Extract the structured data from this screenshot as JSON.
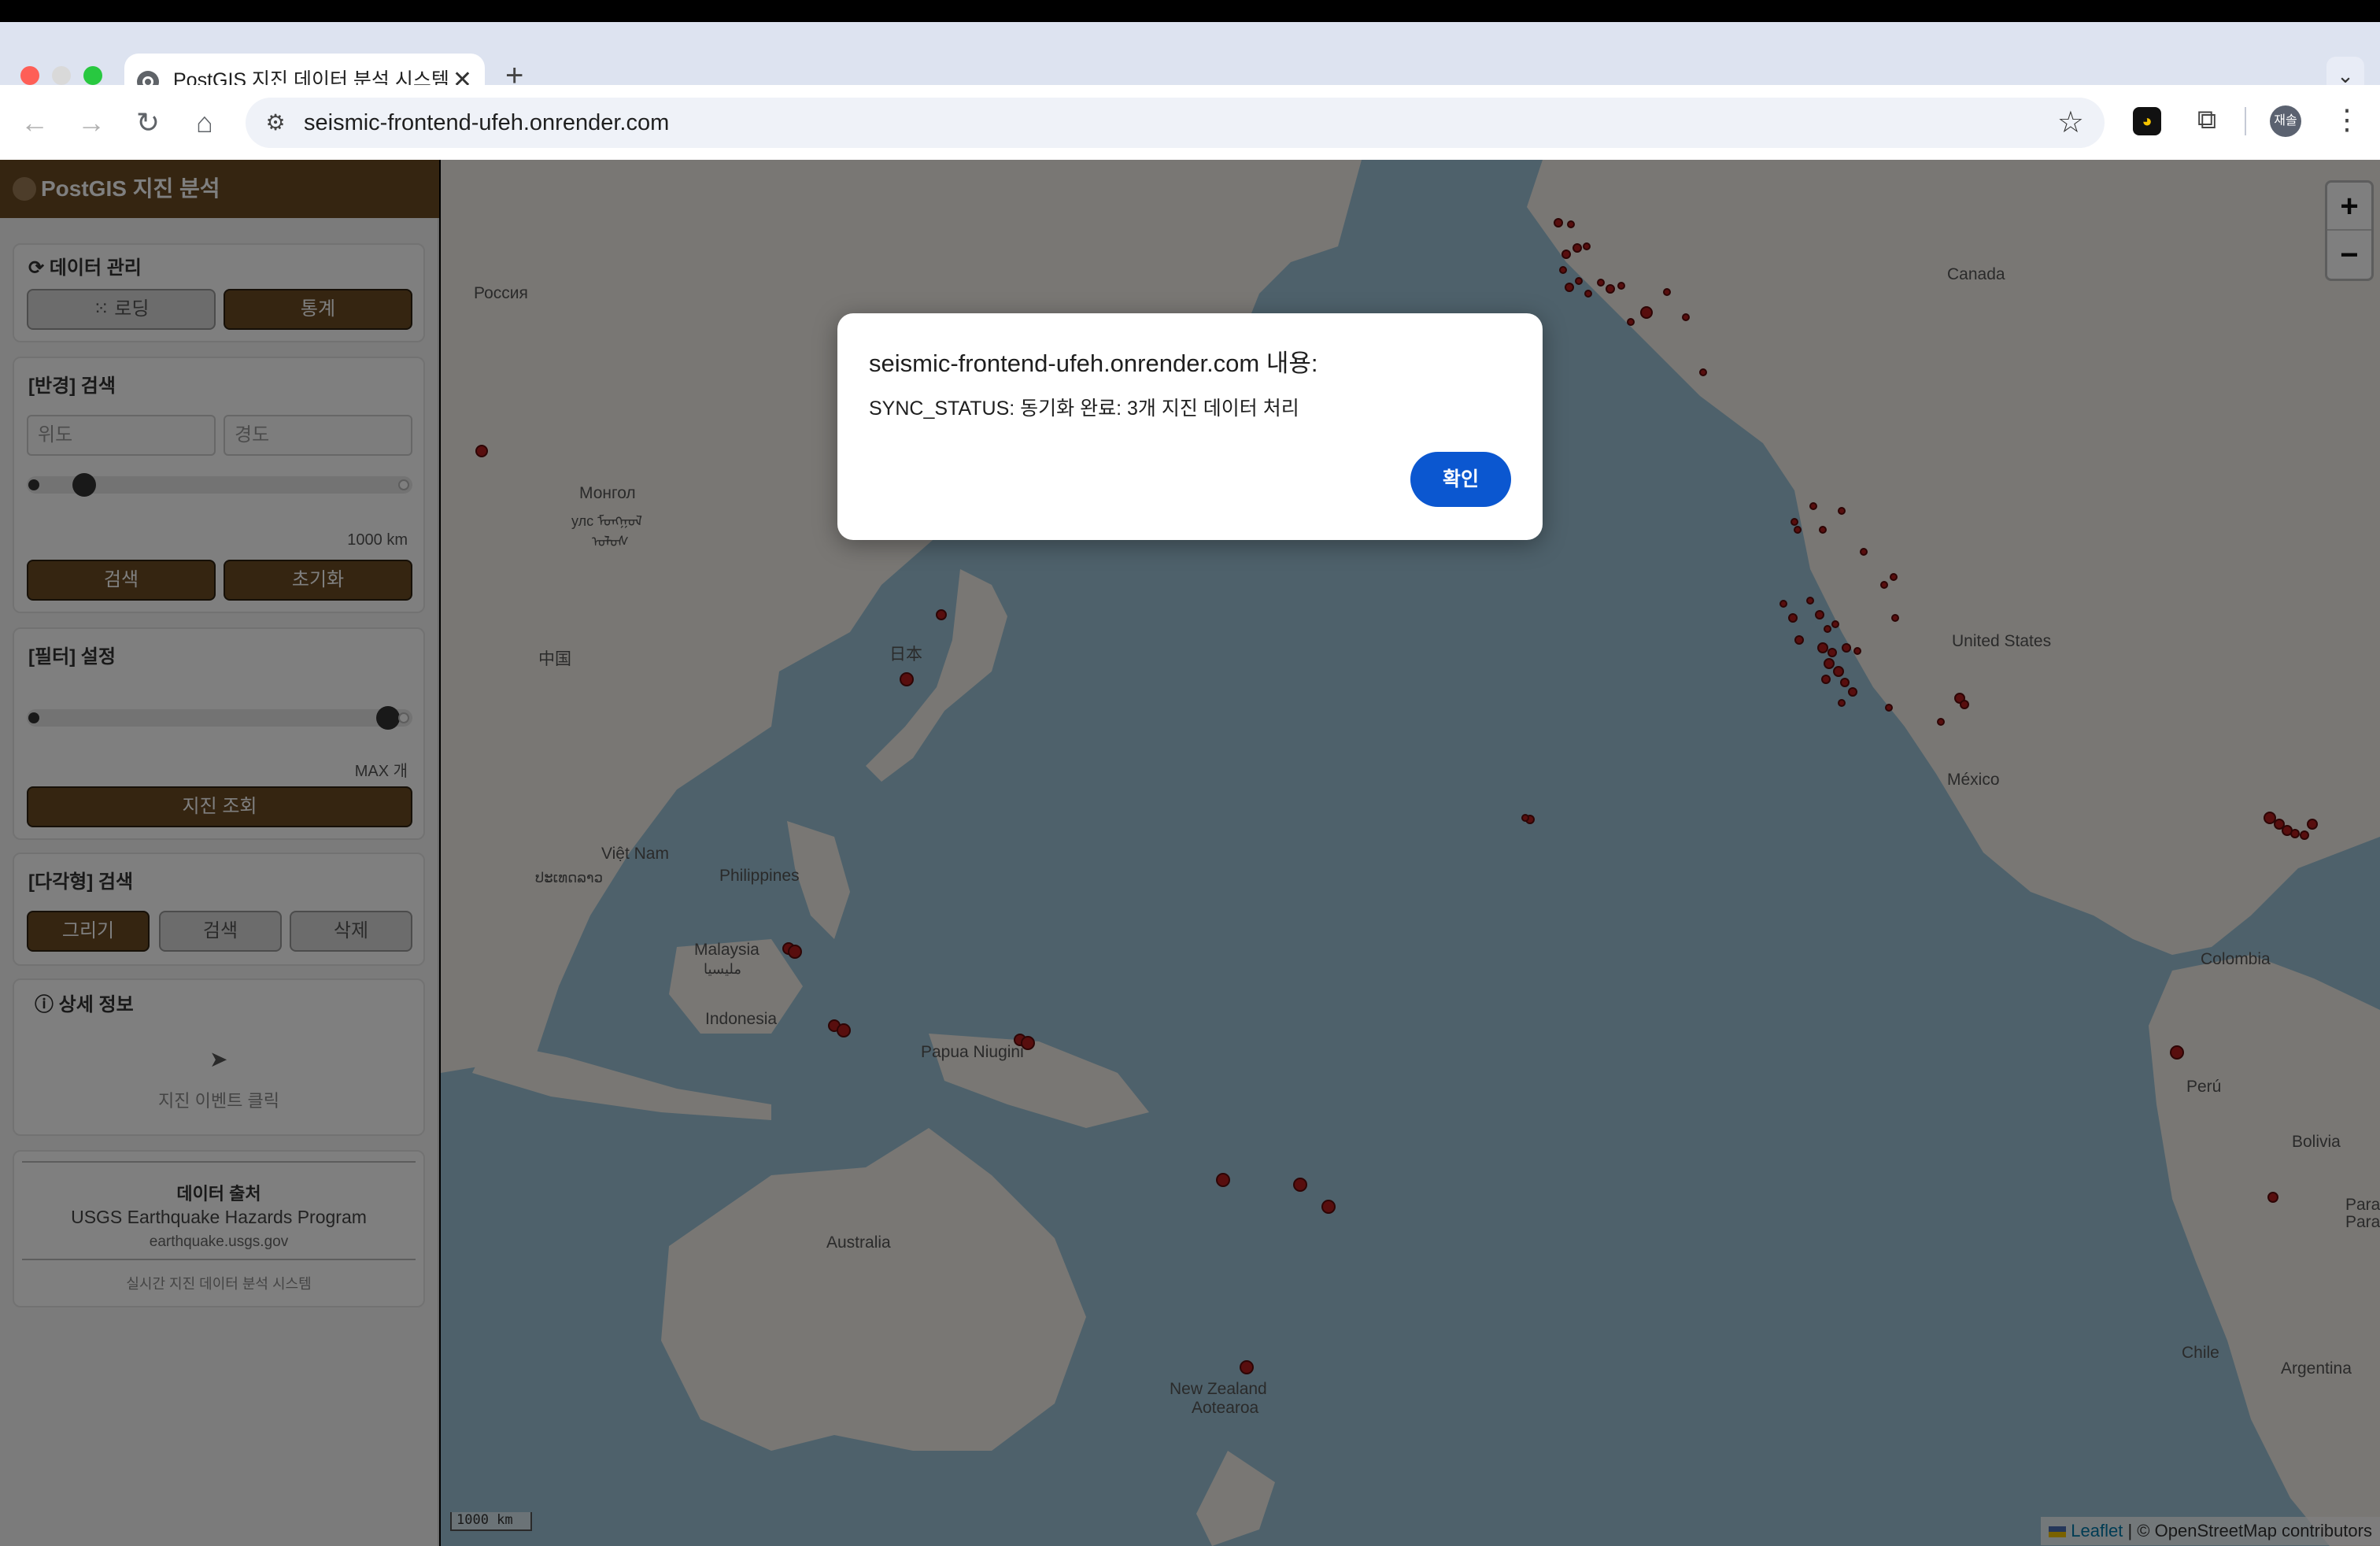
{
  "browser": {
    "tab_title": "PostGIS 지진 데이터 분석 시스템",
    "tab_close": "✕",
    "new_tab": "+",
    "tab_dropdown": "⌄",
    "url": "seismic-frontend-ufeh.onrender.com",
    "profile_initials": "재솔",
    "icons": [
      "back-icon",
      "forward-icon",
      "reload-icon",
      "home-icon",
      "site-info-icon",
      "bookmark-star-icon",
      "extension-icon",
      "puzzle-icon",
      "menu-dots-icon"
    ]
  },
  "sidebar": {
    "brand": "PostGIS 지진 분석",
    "data_mgmt": {
      "title": "데이터 관리",
      "loading_btn": "로딩",
      "stats_btn": "통계"
    },
    "radius": {
      "title": "[반경] 검색",
      "lat_placeholder": "위도",
      "lon_placeholder": "경도",
      "radius_value": "1000 km",
      "search_btn": "검색",
      "reset_btn": "초기화"
    },
    "filter": {
      "title": "[필터] 설정",
      "count_value": "MAX 개",
      "query_btn": "지진 조회"
    },
    "polygon": {
      "title": "[다각형] 검색",
      "draw_btn": "그리기",
      "search_btn": "검색",
      "delete_btn": "삭제"
    },
    "detail": {
      "title": "상세 정보",
      "hint": "지진 이벤트 클릭"
    },
    "source": {
      "title": "데이터 출처",
      "name": "USGS Earthquake Hazards Program",
      "url": "earthquake.usgs.gov",
      "footer": "실시간 지진 데이터 분석 시스템"
    }
  },
  "map": {
    "labels": {
      "russia": "Россия",
      "canada": "Canada",
      "mongolia_1": "Монгол",
      "mongolia_2": "улс ᠮᠣᠩᠭᠣᠯ",
      "mongolia_3": "ᠤᠯᠤᠰ",
      "china": "中国",
      "japan": "日本",
      "usa": "United States",
      "mexico": "México",
      "vietnam": "Việt Nam",
      "philippines": "Philippines",
      "laos": "ປະເທດລາວ",
      "malaysia_1": "Malaysia",
      "malaysia_2": "مليسيا",
      "indonesia": "Indonesia",
      "papua": "Papua Niugini",
      "colombia": "Colombia",
      "peru": "Perú",
      "bolivia": "Bolivia",
      "paraguay_1": "Parag",
      "paraguay_2": "Parag",
      "australia": "Australia",
      "nz_1": "New Zealand",
      "nz_2": "Aotearoa",
      "chile": "Chile",
      "argentina": "Argentina"
    },
    "zoom_in": "+",
    "zoom_out": "−",
    "scale_label": "1000 km",
    "attribution_leaflet": "Leaflet",
    "attribution_rest": " | © OpenStreetMap contributors",
    "colors": {
      "water": "#9cc3d6",
      "land": "#f2efe9",
      "marker": "#b01c1c"
    }
  },
  "dialog": {
    "title": "seismic-frontend-ufeh.onrender.com 내용:",
    "message": "SYNC_STATUS: 동기화 완료: 3개 지진 데이터 처리",
    "ok_btn": "확인"
  }
}
